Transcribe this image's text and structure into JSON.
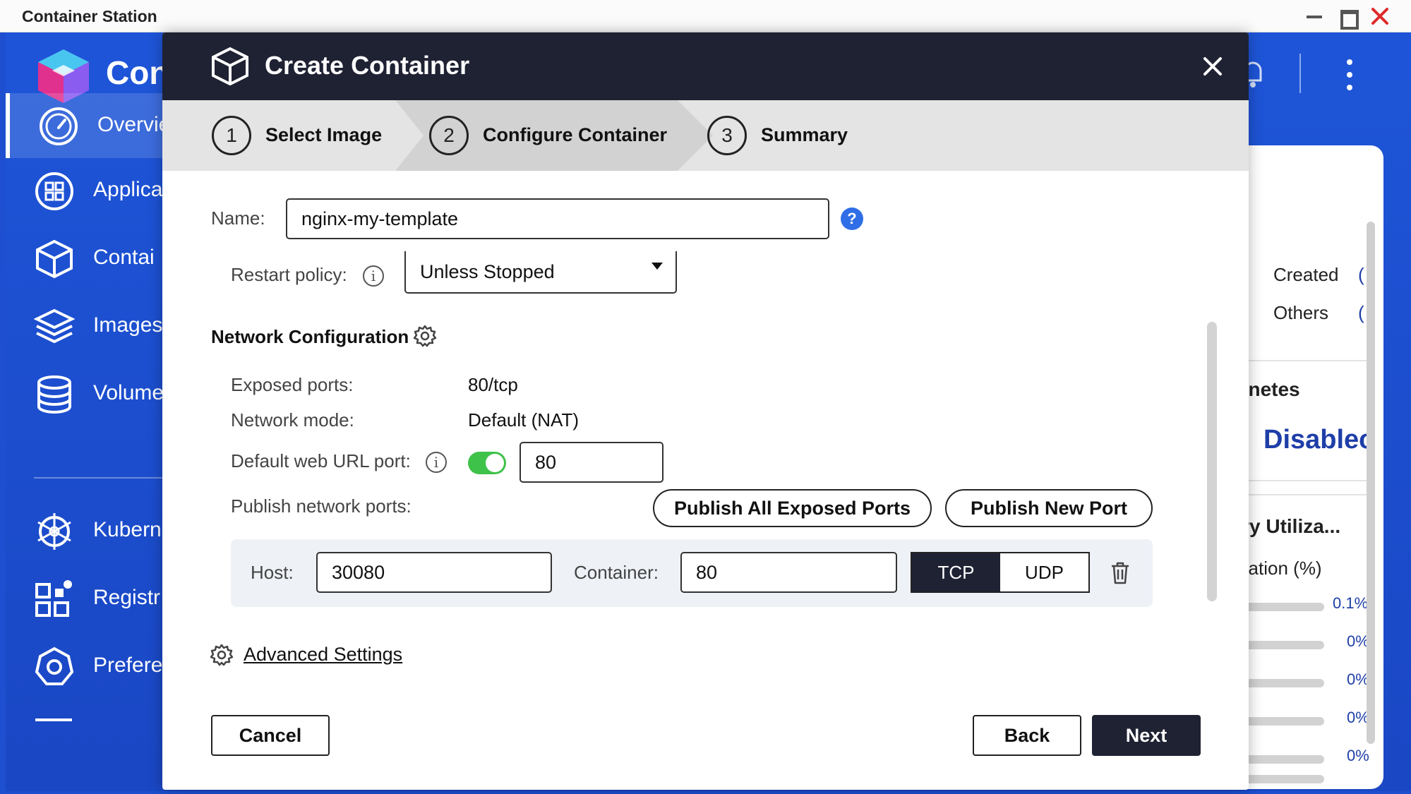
{
  "window": {
    "title": "Container Station"
  },
  "app": {
    "name": "Con",
    "nav": [
      {
        "label": "Overvie",
        "icon": "dashboard-icon"
      },
      {
        "label": "Applica",
        "icon": "applications-icon"
      },
      {
        "label": "Contai",
        "icon": "container-icon"
      },
      {
        "label": "Images",
        "icon": "images-icon"
      },
      {
        "label": "Volume",
        "icon": "volume-icon"
      },
      {
        "label": "Kubern",
        "icon": "kubernetes-icon"
      },
      {
        "label": "Registr",
        "icon": "registry-icon"
      },
      {
        "label": "Prefere",
        "icon": "preferences-icon"
      }
    ]
  },
  "right_panel": {
    "created_label": "Created",
    "others_label": "Others",
    "created_value": "(",
    "others_value": "(",
    "kubernetes_title": "ernetes",
    "kubernetes_status": "Disablec",
    "memory_title": "ory Utiliza...",
    "utilization_label": "lization (%)",
    "values": [
      "0.1%",
      "0%",
      "0%",
      "0%",
      "0%"
    ]
  },
  "modal": {
    "title": "Create Container",
    "steps": [
      {
        "number": "1",
        "label": "Select Image"
      },
      {
        "number": "2",
        "label": "Configure Container"
      },
      {
        "number": "3",
        "label": "Summary"
      }
    ],
    "name_label": "Name:",
    "name_value": "nginx-my-template",
    "help_glyph": "?",
    "info_glyph": "i",
    "restart_label": "Restart policy:",
    "restart_value": "Unless Stopped",
    "network_title": "Network Configuration",
    "exposed_label": "Exposed ports:",
    "exposed_value": "80/tcp",
    "mode_label": "Network mode:",
    "mode_value": "Default (NAT)",
    "weburl_label": "Default web URL port:",
    "weburl_value": "80",
    "publish_label": "Publish network ports:",
    "publish_all": "Publish All Exposed Ports",
    "publish_new": "Publish New Port",
    "host_label": "Host:",
    "host_value": "30080",
    "container_label": "Container:",
    "container_value": "80",
    "tcp": "TCP",
    "udp": "UDP",
    "advanced": "Advanced Settings",
    "cancel": "Cancel",
    "back": "Back",
    "next": "Next"
  }
}
